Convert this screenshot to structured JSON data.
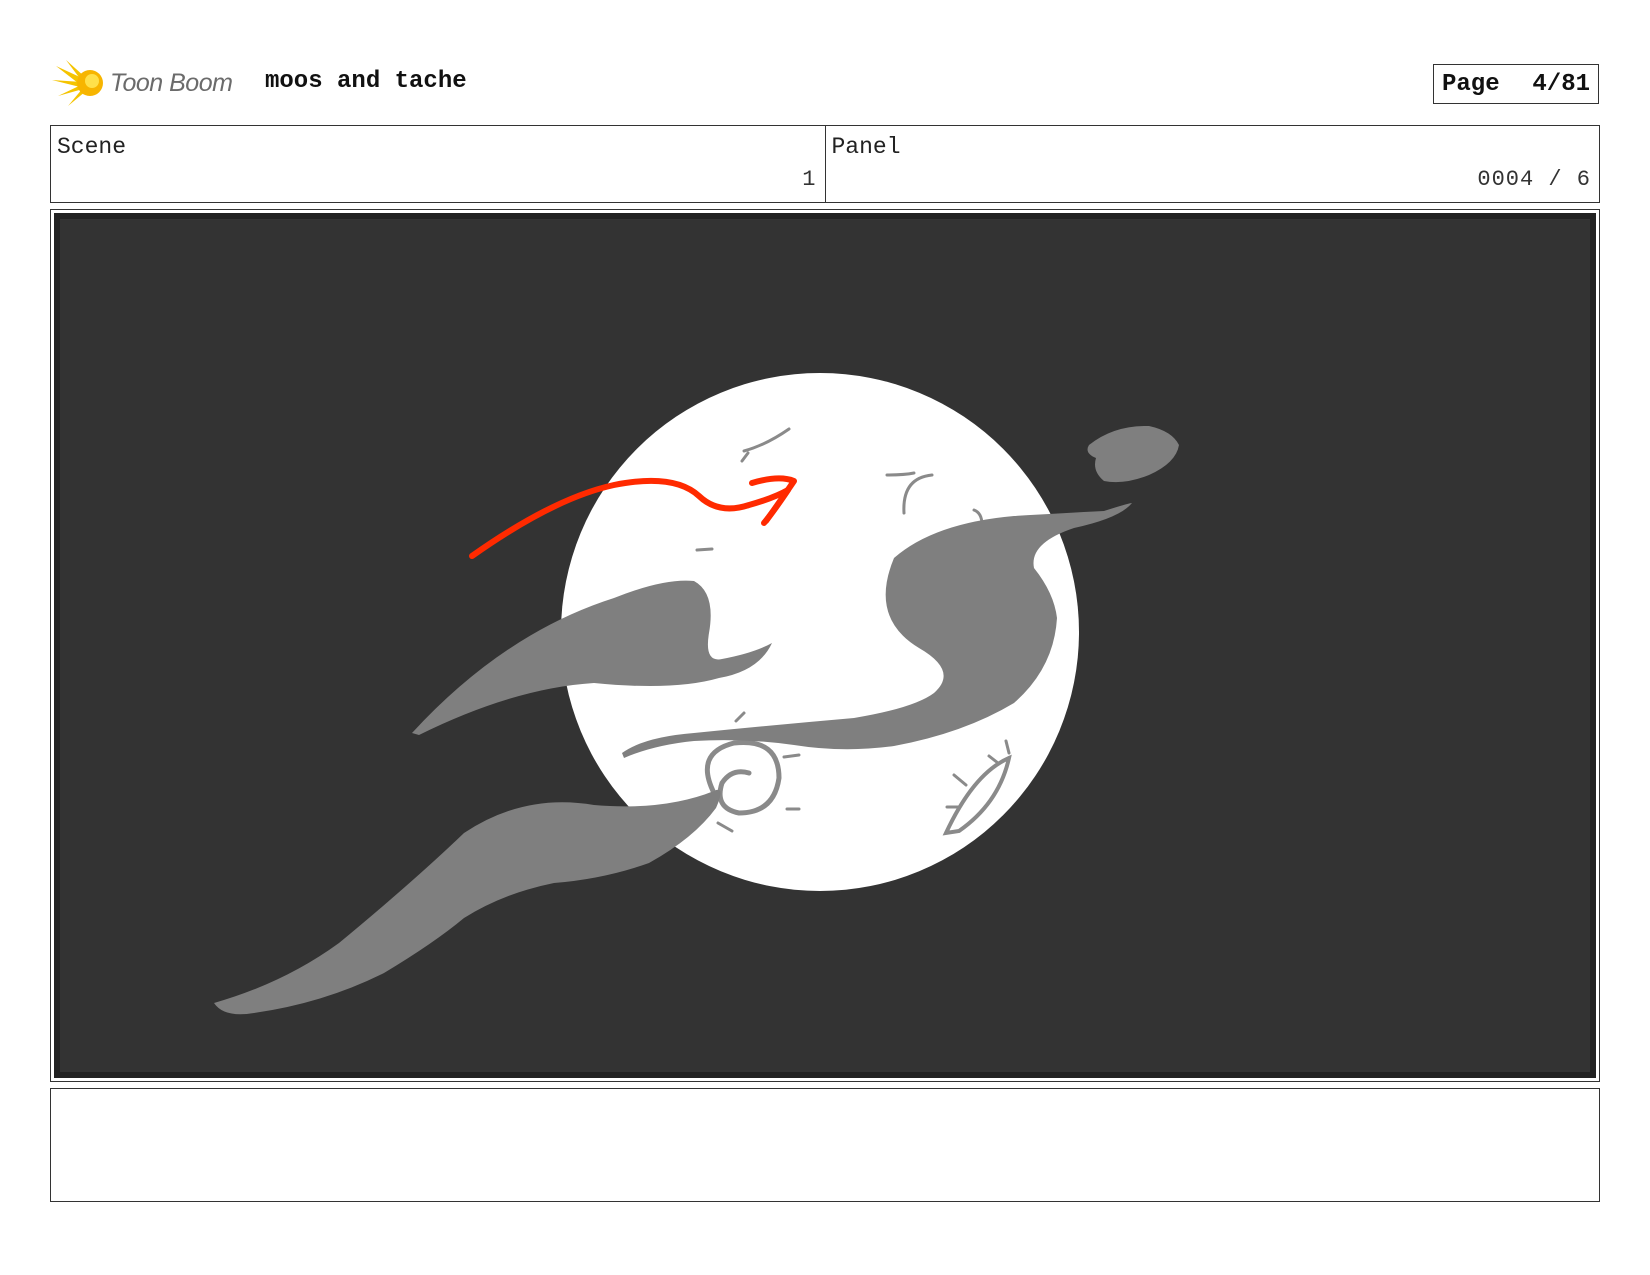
{
  "header": {
    "logo_text": "Toon Boom",
    "project_title": "moos and tache",
    "page_label": "Page",
    "page_number": "4/81"
  },
  "scene": {
    "label": "Scene",
    "value": "1"
  },
  "panel": {
    "label": "Panel",
    "value": "0004 / 6"
  },
  "artwork": {
    "background_color": "#333333",
    "moon_color": "#ffffff",
    "cloud_color": "#7f7f7f",
    "arrow_color": "#ff2a00"
  },
  "notes": {
    "text": ""
  },
  "icons": [
    "toon-boom-logo-icon"
  ]
}
